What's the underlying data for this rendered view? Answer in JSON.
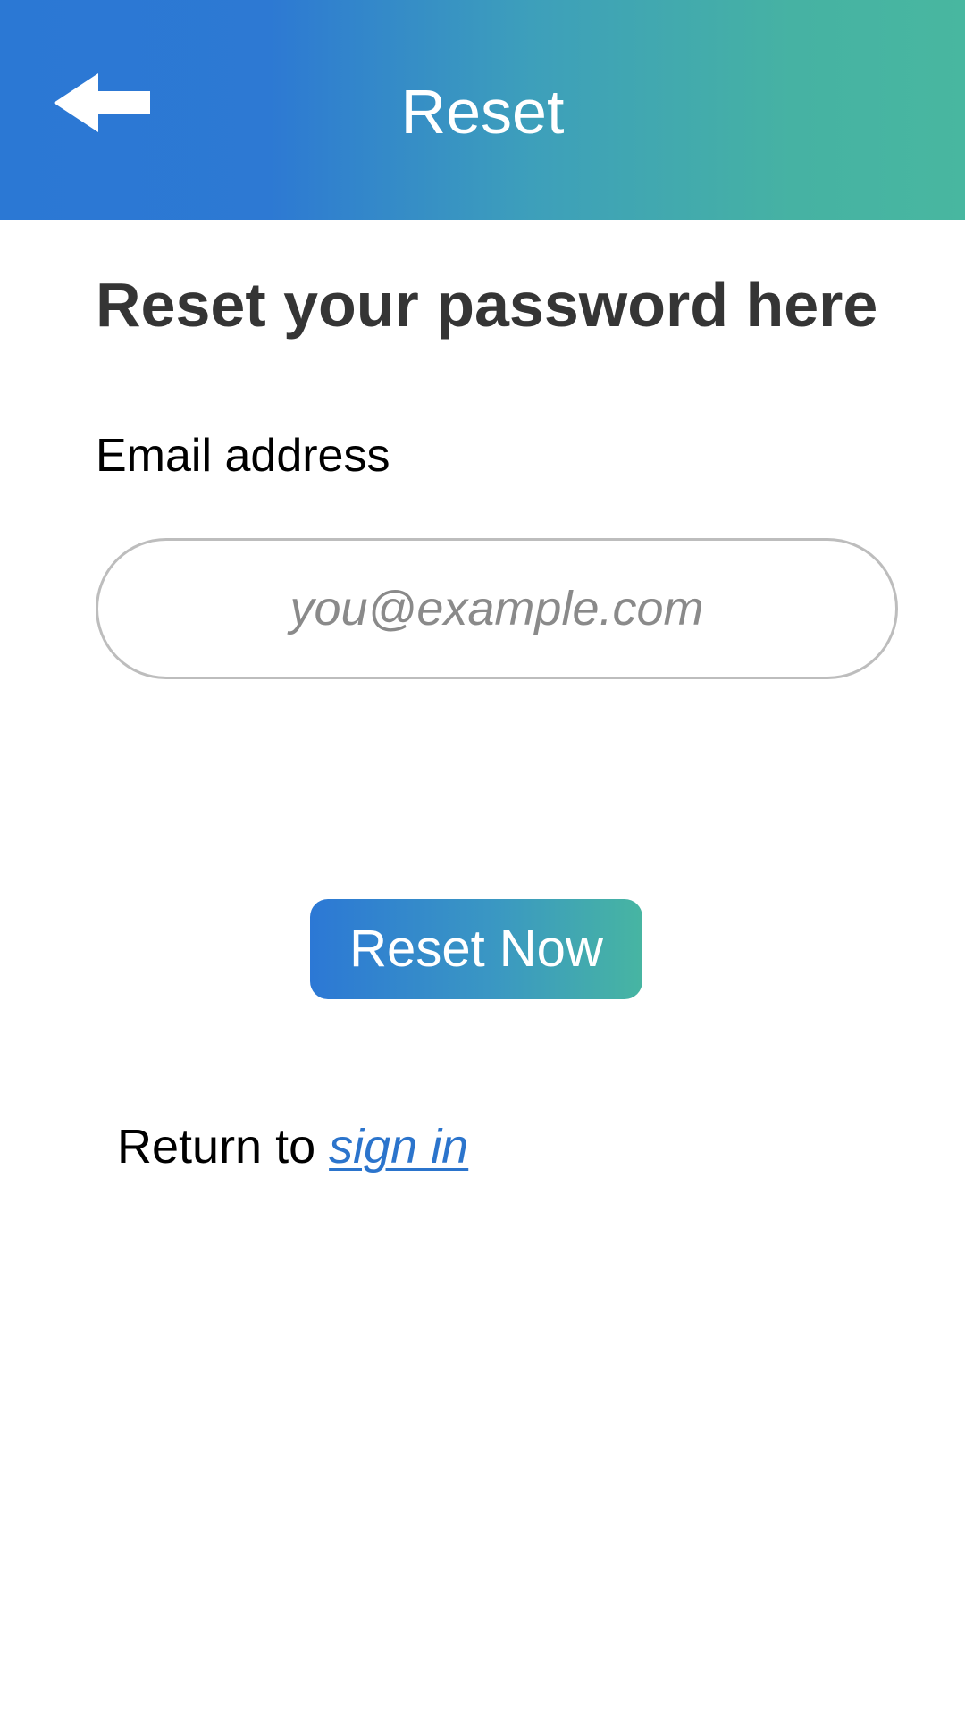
{
  "header": {
    "title": "Reset",
    "back_icon": "arrow-left-icon",
    "gradient_start": "#2b78d4",
    "gradient_end": "#48b7a0"
  },
  "form": {
    "heading": "Reset your password here",
    "email_label": "Email address",
    "email_value": "",
    "email_placeholder": "you@example.com",
    "submit_label": "Reset Now"
  },
  "footer": {
    "return_text": "Return to ",
    "sign_in_link": "sign in",
    "link_color": "#2b74cc"
  }
}
